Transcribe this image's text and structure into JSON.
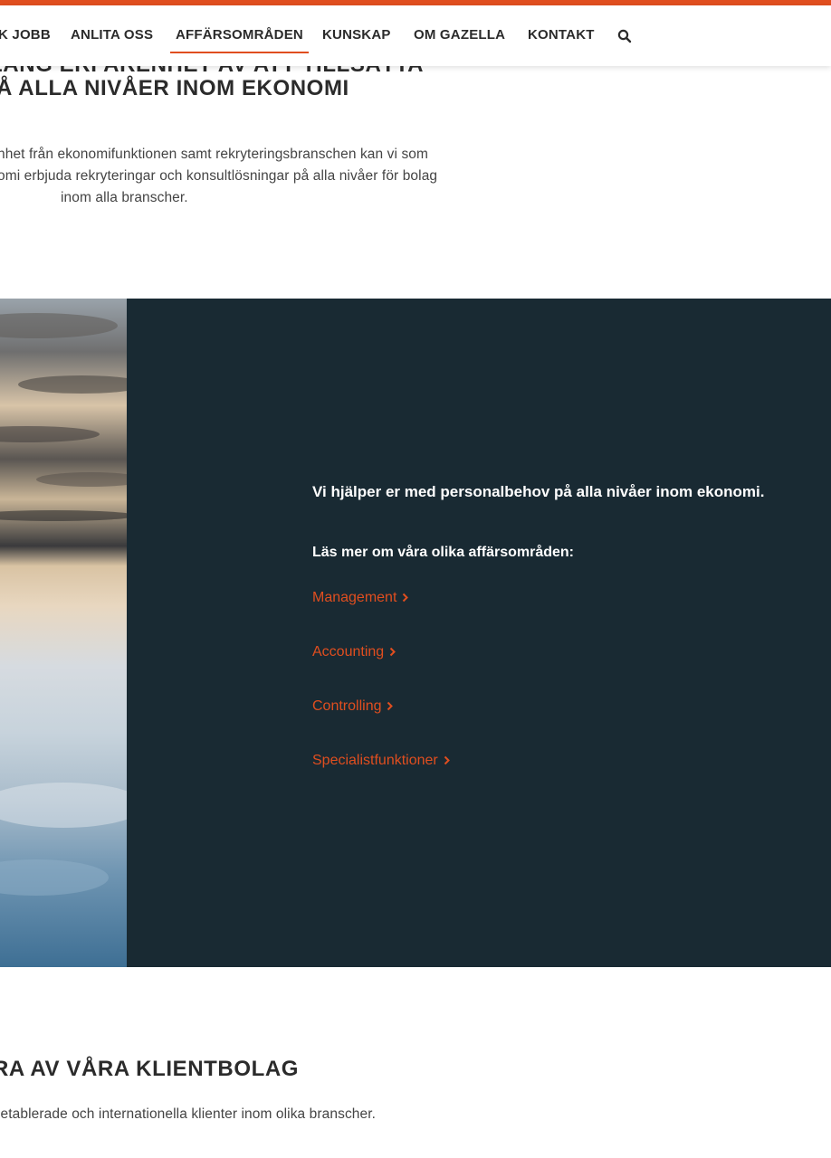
{
  "brand": {
    "accent_color": "#e04e1f",
    "panel_color": "#192a33"
  },
  "nav": {
    "items": [
      {
        "label": "K JOBB"
      },
      {
        "label": "ANLITA OSS"
      },
      {
        "label": "AFFÄRSOMRÅDEN",
        "active": true
      },
      {
        "label": "KUNSKAP"
      },
      {
        "label": "OM GAZELLA"
      },
      {
        "label": "KONTAKT"
      }
    ],
    "search_icon": "search-icon"
  },
  "intro": {
    "heading_line1": "LÅNG ERFARENHET AV ATT TILLSÄTTA",
    "heading_line2": "Å ALLA NIVÅER INOM EKONOMI",
    "text_line1": "nhet från ekonomifunktionen samt rekryteringsbranschen kan vi som",
    "text_line2": "omi erbjuda rekryteringar och konsultlösningar på alla nivåer för bolag",
    "text_line3": "inom alla branscher."
  },
  "areas": {
    "title": "Vi hjälper er med personalbehov på alla nivåer inom ekonomi.",
    "subtitle": "Läs mer om våra olika affärsområden:",
    "links": [
      {
        "label": "Management"
      },
      {
        "label": "Accounting"
      },
      {
        "label": "Controlling"
      },
      {
        "label": "Specialistfunktioner"
      }
    ]
  },
  "clients": {
    "heading": "RA AV VÅRA KLIENTBOLAG",
    "text": "letablerade och internationella klienter inom olika branscher."
  }
}
